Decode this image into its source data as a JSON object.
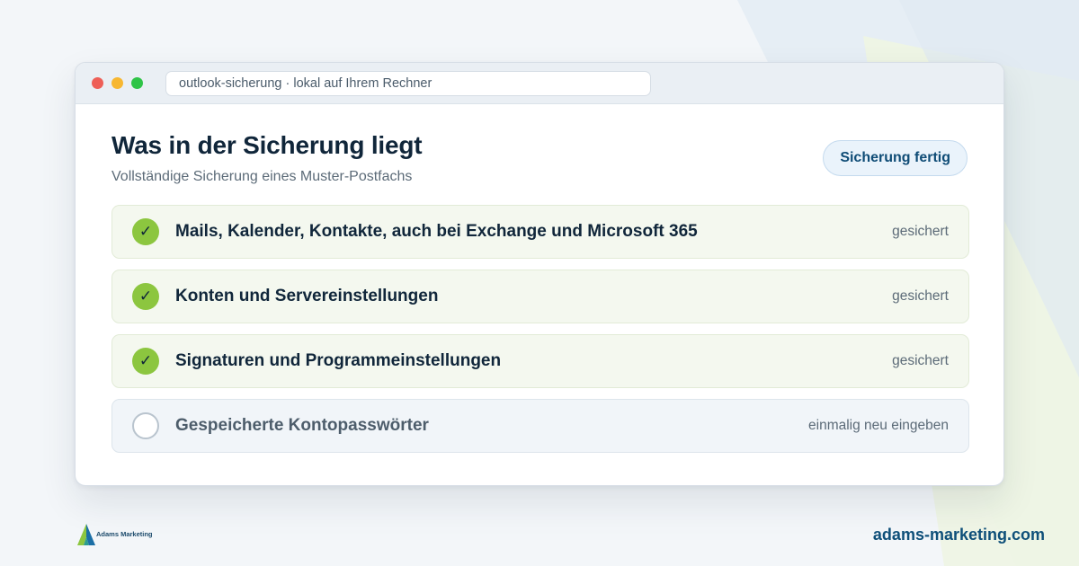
{
  "window": {
    "address": "outlook-sicherung · lokal auf Ihrem Rechner"
  },
  "header": {
    "title": "Was in der Sicherung liegt",
    "subtitle": "Vollständige Sicherung eines Muster-Postfachs",
    "status_badge": "Sicherung fertig"
  },
  "items": [
    {
      "label": "Mails, Kalender, Kontakte, auch bei Exchange und Microsoft 365",
      "status": "gesichert",
      "done": true,
      "icon": "check-icon"
    },
    {
      "label": "Konten und Servereinstellungen",
      "status": "gesichert",
      "done": true,
      "icon": "check-icon"
    },
    {
      "label": "Signaturen und Programmeinstellungen",
      "status": "gesichert",
      "done": true,
      "icon": "check-icon"
    },
    {
      "label": "Gespeicherte Kontopasswörter",
      "status": "einmalig neu eingeben",
      "done": false,
      "icon": "empty-circle-icon"
    }
  ],
  "footer": {
    "logo_text": "Adams Marketing",
    "url": "adams-marketing.com"
  },
  "colors": {
    "accent_green": "#8cc63f",
    "brand_blue": "#0e4f79",
    "heading": "#10263a"
  }
}
